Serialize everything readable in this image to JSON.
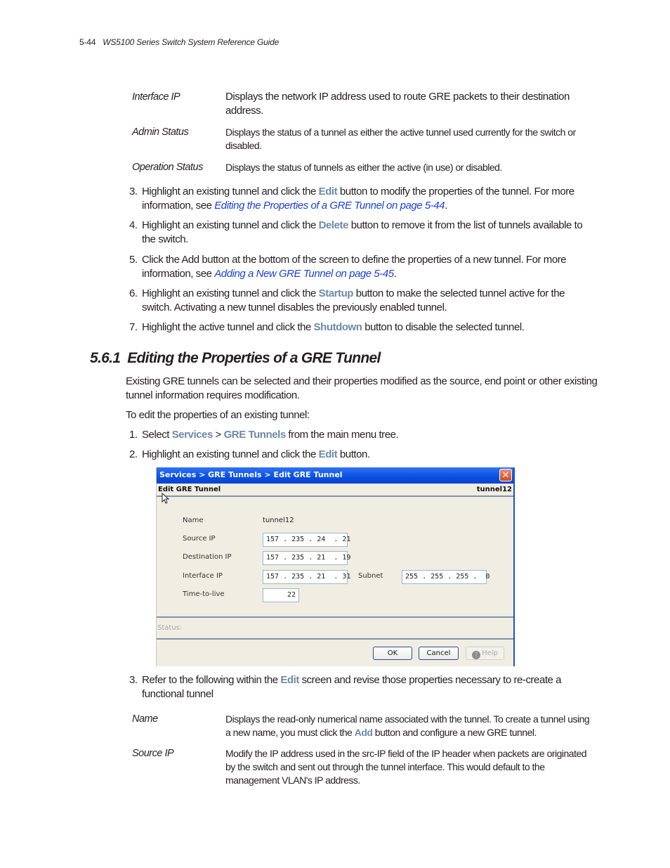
{
  "page_header": {
    "page_number": "5-44",
    "guide_title": "WS5100 Series Switch System Reference Guide"
  },
  "top_definitions": [
    {
      "term": "Interface IP",
      "lines": [
        "Displays the network IP address used to route GRE packets to their destination",
        "address."
      ]
    },
    {
      "term": "Admin Status",
      "lines": [
        "Displays the status of a tunnel as either the active tunnel used currently for the switch or",
        "disabled."
      ]
    },
    {
      "term": "Operation Status",
      "lines": [
        "Displays the status of tunnels as either the active (in use) or disabled."
      ]
    }
  ],
  "steps_top": [
    {
      "num": "3.",
      "pre": "Highlight an existing tunnel and click the ",
      "kw": "Edit",
      "post": " button to modify the properties of the tunnel. For more",
      "line2_pre": "information, see ",
      "link": "Editing the Properties of a GRE Tunnel on page 5-44",
      "line2_post": "."
    },
    {
      "num": "4.",
      "pre": "Highlight an existing tunnel and click the ",
      "kw": "Delete",
      "post": " button to remove it from the list of tunnels available to",
      "line2_pre": "the switch.",
      "link": "",
      "line2_post": ""
    },
    {
      "num": "5.",
      "pre": "Click the Add button at the bottom of the screen to define the properties of a new tunnel. For more",
      "kw": "",
      "post": "",
      "line2_pre": "information, see ",
      "link": "Adding a New GRE Tunnel on page 5-45",
      "line2_post": "."
    },
    {
      "num": "6.",
      "pre": "Highlight an existing tunnel and click the ",
      "kw": "Startup",
      "post": " button to make the selected tunnel active for the",
      "line2_pre": "switch. Activating a new tunnel disables the previously enabled tunnel.",
      "link": "",
      "line2_post": ""
    },
    {
      "num": "7.",
      "pre": "Highlight the active tunnel and click the ",
      "kw": "Shutdown",
      "post": " button to disable the selected tunnel.",
      "line2_pre": "",
      "link": "",
      "line2_post": ""
    }
  ],
  "section": {
    "number": "5.6.1",
    "title": "Editing the Properties of a GRE Tunnel",
    "intro_line1": "Existing GRE tunnels can be selected and their properties modified as the source, end point or other existing",
    "intro_line2": "tunnel information requires modification.",
    "lead_in": "To edit the properties of an existing tunnel:",
    "step1": {
      "num": "1.",
      "pre": "Select ",
      "kw1": "Services",
      "sep": " > ",
      "kw2": "GRE Tunnels",
      "post": " from the main menu tree."
    },
    "step2": {
      "num": "2.",
      "pre": "Highlight an existing tunnel and click the ",
      "kw": "Edit",
      "post": " button."
    },
    "step3": {
      "num": "3.",
      "pre": "Refer to the following within the ",
      "kw": "Edit",
      "post": " screen and revise those properties necessary to re-create a",
      "line2": "functional tunnel"
    }
  },
  "dialog": {
    "title": "Services > GRE Tunnels > Edit GRE Tunnel",
    "close_glyph": "✕",
    "subtitle": "Edit GRE Tunnel",
    "tunnel_tag": "tunnel12",
    "fields": {
      "name_label": "Name",
      "name_value": "tunnel12",
      "source_ip_label": "Source IP",
      "source_ip": "157 . 235 . 24  . 21",
      "destination_ip_label": "Destination IP",
      "destination_ip": "157 . 235 . 21  . 19",
      "interface_ip_label": "Interface IP",
      "interface_ip": "157 . 235 . 21  . 31",
      "subnet_label": "Subnet",
      "subnet": "255 . 255 . 255 .  0",
      "ttl_label": "Time-to-live",
      "ttl": "22"
    },
    "status_label": "Status:",
    "buttons": {
      "ok": "OK",
      "cancel": "Cancel",
      "help": "Help",
      "help_glyph": "?"
    }
  },
  "bottom_definitions": [
    {
      "term": "Name",
      "line1": "Displays the read-only numerical name associated with the tunnel. To create a tunnel using",
      "line2_pre": "a new name, you must click the ",
      "line2_kw": "Add",
      "line2_post": " button and configure a new GRE tunnel."
    },
    {
      "term": "Source IP",
      "line1": "Modify the IP address used in the src-IP field of the IP header when packets are originated",
      "line2": "by the switch and sent out through the tunnel interface. This would default to the",
      "line3": "management VLAN's IP address."
    }
  ]
}
